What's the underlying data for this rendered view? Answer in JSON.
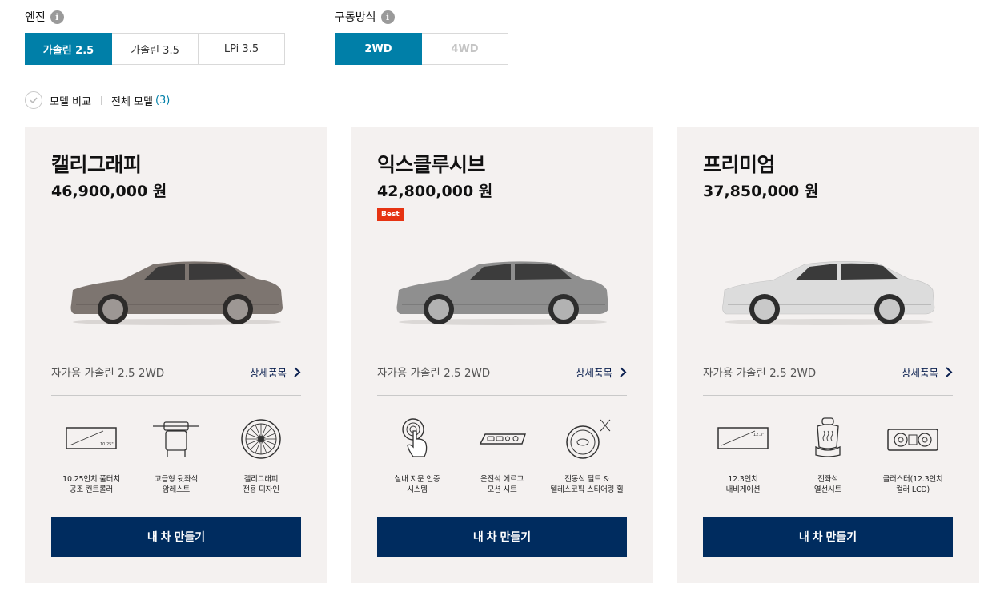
{
  "engine": {
    "label": "엔진",
    "options": [
      "가솔린 2.5",
      "가솔린 3.5",
      "LPi 3.5"
    ],
    "selected": "가솔린 2.5"
  },
  "drive": {
    "label": "구동방식",
    "options": [
      "2WD",
      "4WD"
    ],
    "selected": "2WD"
  },
  "compare": {
    "compare_label": "모델 비교",
    "all_label": "전체 모델",
    "count": "(3)"
  },
  "cards": [
    {
      "name": "캘리그래피",
      "price": "46,900,000 원",
      "trim": "자가용 가솔린 2.5 2WD",
      "detail_label": "상세품목",
      "car_color": "#7d7570",
      "features": [
        {
          "icon": "infotainment-display-icon",
          "label": "10.25인치 풀터치\n공조 컨트롤러",
          "screen_text": "10.25\""
        },
        {
          "icon": "rear-armrest-icon",
          "label": "고급형 뒷좌석\n암레스트"
        },
        {
          "icon": "wheel-icon",
          "label": "캘리그래피\n전용 디자인"
        }
      ],
      "build_label": "내 차 만들기"
    },
    {
      "name": "익스클루시브",
      "price": "42,800,000 원",
      "badge": "Best",
      "trim": "자가용 가솔린 2.5 2WD",
      "detail_label": "상세품목",
      "car_color": "#8f8f8f",
      "features": [
        {
          "icon": "fingerprint-icon",
          "label": "실내 지문 인증\n시스템"
        },
        {
          "icon": "seat-control-icon",
          "label": "운전석 에르고\n모션 시트"
        },
        {
          "icon": "steering-wheel-icon",
          "label": "전동식 틸트 &\n텔레스코픽 스티어링 휠"
        }
      ],
      "build_label": "내 차 만들기"
    },
    {
      "name": "프리미엄",
      "price": "37,850,000 원",
      "trim": "자가용 가솔린 2.5 2WD",
      "detail_label": "상세품목",
      "car_color": "#dcdcdc",
      "features": [
        {
          "icon": "navigation-display-icon",
          "label": "12.3인치\n내비게이션",
          "screen_text": "12.3\""
        },
        {
          "icon": "heated-seat-icon",
          "label": "전좌석\n열선시트"
        },
        {
          "icon": "cluster-icon",
          "label": "클러스터(12.3인치\n컬러 LCD)"
        }
      ],
      "build_label": "내 차 만들기"
    }
  ]
}
